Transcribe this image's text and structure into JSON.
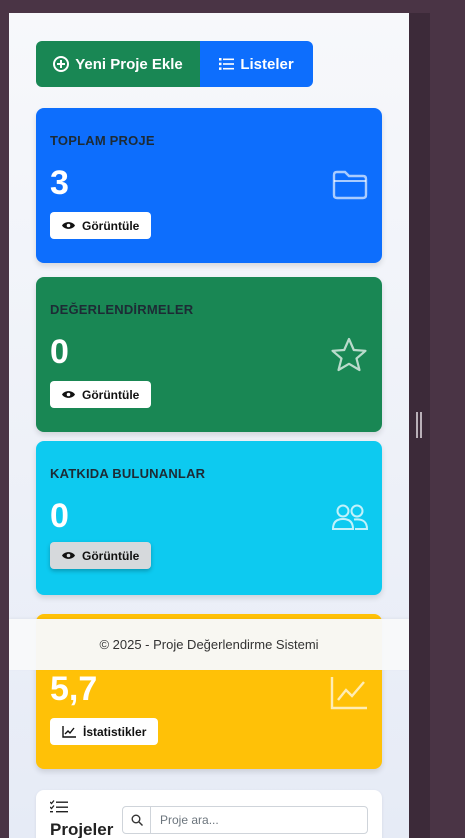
{
  "actions": {
    "add_project_label": "Yeni Proje Ekle",
    "lists_label": "Listeler"
  },
  "cards": [
    {
      "title": "TOPLAM PROJE",
      "value": "3",
      "button": "Görüntüle",
      "icon": "folder-icon",
      "color": "#0d6efd"
    },
    {
      "title": "DEĞERLENDİRMELER",
      "value": "0",
      "button": "Görüntüle",
      "icon": "star-icon",
      "color": "#198754"
    },
    {
      "title": "KATKIDA BULUNANLAR",
      "value": "0",
      "button": "Görüntüle",
      "icon": "people-icon",
      "color": "#0dcaf0"
    },
    {
      "title": "",
      "value": "5,7",
      "button": "İstatistikler",
      "icon": "chart-line-icon",
      "color": "#ffc107"
    }
  ],
  "footer": {
    "text": "© 2025 - Proje Değerlendirme Sistemi"
  },
  "projects": {
    "title": "Projeler",
    "search_placeholder": "Proje ara..."
  }
}
